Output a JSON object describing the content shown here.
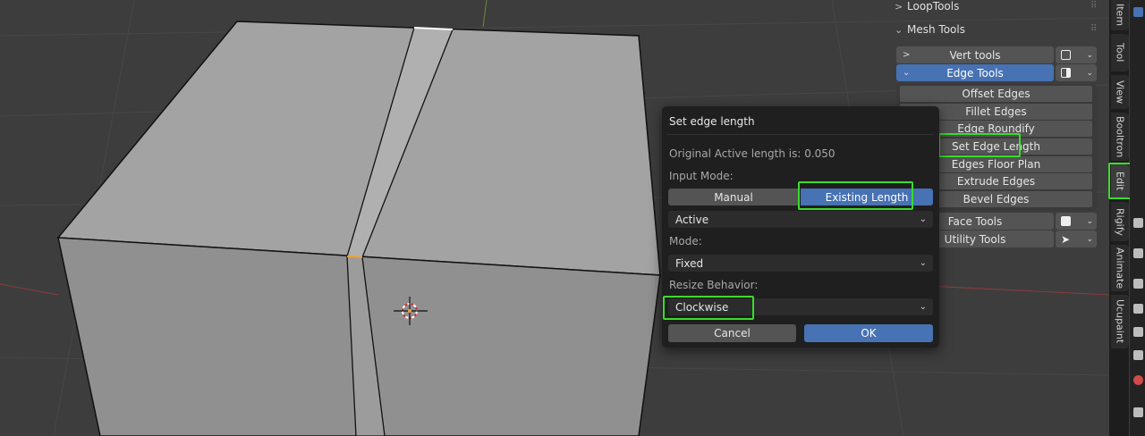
{
  "npanel": {
    "looptools_label": "LoopTools",
    "meshtools_label": "Mesh Tools",
    "vert_tools": "Vert tools",
    "edge_tools": "Edge Tools",
    "edge_items": [
      "Offset Edges",
      "Fillet Edges",
      "Edge Roundify",
      "Set Edge Length",
      "Edges Floor Plan",
      "Extrude Edges",
      "Bevel Edges"
    ],
    "face_tools": "Face Tools",
    "utility_tools": "Utility Tools"
  },
  "tabs": [
    "Item",
    "Tool",
    "View",
    "Booltron",
    "Edit",
    "Rigify",
    "Animate",
    "Ucupaint"
  ],
  "active_tab": "Edit",
  "dialog": {
    "title": "Set edge length",
    "original_length": "Original Active length is: 0.050",
    "input_mode_label": "Input Mode:",
    "input_mode_options": [
      "Manual",
      "Existing Length"
    ],
    "input_mode_selected": "Existing Length",
    "length_source": "Active",
    "mode_label": "Mode:",
    "mode_value": "Fixed",
    "resize_label": "Resize Behavior:",
    "resize_value": "Clockwise",
    "cancel_label": "Cancel",
    "ok_label": "OK"
  },
  "colors": {
    "highlight": "#3bdc2c",
    "accent": "#4772b3",
    "viewport_bg": "#3d3d3d"
  }
}
